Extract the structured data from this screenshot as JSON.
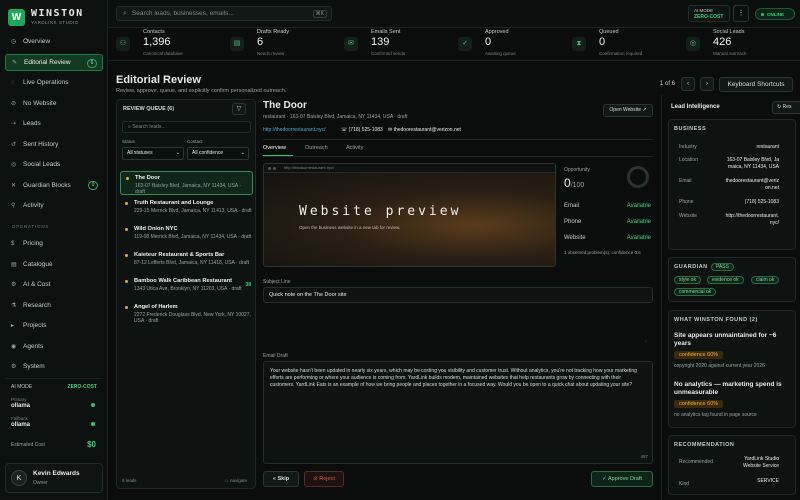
{
  "brand": {
    "name": "WINSTON",
    "subtitle": "YARDLINK STUDIO",
    "logo_letter": "W"
  },
  "nav": [
    {
      "label": "Overview",
      "icon": "dashboard-icon",
      "glyph": "◷"
    },
    {
      "label": "Editorial Review",
      "icon": "edit-icon",
      "glyph": "✎",
      "badge": "6",
      "active": true
    },
    {
      "label": "Live Operations",
      "icon": "pulse-icon",
      "glyph": "◌"
    },
    {
      "label": "No Website",
      "icon": "globe-off-icon",
      "glyph": "⊘"
    },
    {
      "label": "Leads",
      "icon": "target-icon",
      "glyph": "⇢"
    },
    {
      "label": "Sent History",
      "icon": "history-icon",
      "glyph": "↺"
    },
    {
      "label": "Social Leads",
      "icon": "social-icon",
      "glyph": "◎"
    },
    {
      "label": "Guardian Blocks",
      "icon": "shield-x-icon",
      "glyph": "✕",
      "badge": "0"
    },
    {
      "label": "Activity",
      "icon": "activity-icon",
      "glyph": "⚲"
    }
  ],
  "operations_label": "OPERATIONS",
  "ops_nav": [
    {
      "label": "Pricing",
      "icon": "dollar-icon",
      "glyph": "$"
    },
    {
      "label": "Catalogue",
      "icon": "book-icon",
      "glyph": "▤"
    },
    {
      "label": "AI & Cost",
      "icon": "gear-icon",
      "glyph": "⚙"
    },
    {
      "label": "Research",
      "icon": "research-icon",
      "glyph": "⚗"
    },
    {
      "label": "Projects",
      "icon": "folder-icon",
      "glyph": "▸"
    },
    {
      "label": "Agents",
      "icon": "agent-icon",
      "glyph": "◉"
    },
    {
      "label": "System",
      "icon": "system-icon",
      "glyph": "⚙"
    }
  ],
  "ai_mode": {
    "label": "AI MODE",
    "mode": "ZERO-COST",
    "primary_label": "Primary",
    "primary": "ollama",
    "fallback_label": "Fallback",
    "fallback": "ollama",
    "cost_label": "Estimated Cost",
    "cost": "$0"
  },
  "user": {
    "initial": "K",
    "name": "Kevin Edwards",
    "role": "Owner"
  },
  "topbar": {
    "search_placeholder": "Search leads, businesses, emails...",
    "kbd": "⌘K",
    "mode_label": "AI MODE",
    "mode_value": "ZERO-COST",
    "status": "ONLINE"
  },
  "stats": [
    {
      "label": "Contacts",
      "value": "1,396",
      "sub": "Canonical database",
      "icon": "users-icon",
      "glyph": "⚇"
    },
    {
      "label": "Drafts Ready",
      "value": "6",
      "sub": "Needs review",
      "icon": "draft-icon",
      "glyph": "▤"
    },
    {
      "label": "Emails Sent",
      "value": "139",
      "sub": "Confirmed sends",
      "icon": "send-icon",
      "glyph": "✉"
    },
    {
      "label": "Approved",
      "value": "0",
      "sub": "Awaiting queue",
      "icon": "check-icon",
      "glyph": "✓"
    },
    {
      "label": "Queued",
      "value": "0",
      "sub": "Confirmation required",
      "icon": "hourglass-icon",
      "glyph": "⧗"
    },
    {
      "label": "Social Leads",
      "value": "426",
      "sub": "Manual outreach",
      "icon": "social-icon",
      "glyph": "◎"
    }
  ],
  "review": {
    "title": "Editorial Review",
    "subtitle": "Review, approve, queue, and explicitly confirm personalized outreach.",
    "pager": "1 of 6",
    "prev": "‹",
    "next": "›",
    "shortcuts": "Keyboard Shortcuts"
  },
  "queue": {
    "title": "REVIEW QUEUE (6)",
    "search_placeholder": "Search leads...",
    "status_label": "Status",
    "status_value": "All statuses",
    "contact_label": "Contact",
    "contact_value": "All confidence",
    "items": [
      {
        "name": "The Door",
        "detail": "163-07 Baisley Blvd, Jamaica, NY 11434, USA · draft",
        "selected": true
      },
      {
        "name": "Truth Restaurant and Lounge",
        "detail": "229-15 Merrick Blvd, Jamaica, NY 11413, USA · draft"
      },
      {
        "name": "Wild Onion NYC",
        "detail": "119-08 Merrick Blvd, Jamaica, NY 11434, USA · draft"
      },
      {
        "name": "Kaieteur Restaurant & Sports Bar",
        "detail": "87-12 Lefferts Blvd, Jamaica, NY 11418, USA · draft"
      },
      {
        "name": "Bamboo Walk Caribbean Restaurant",
        "detail": "1343 Utica Ave, Brooklyn, NY 11203, USA · draft",
        "score": "38"
      },
      {
        "name": "Angel of Harlem",
        "detail": "2272 Frederick Douglass Blvd, New York, NY 10027, USA · draft"
      }
    ],
    "footer_left": "6 leads",
    "footer_right": "↑↓ navigate"
  },
  "detail": {
    "name": "The Door",
    "meta": "restaurant · 163-07 Baisley Blvd, Jamaica, NY 11434, USA · draft",
    "url": "http://thedoorrestaurant.nyc/",
    "phone": "☏ (718) 525-1083",
    "email": "✉ thedoorestaurant@verizon.net",
    "open_site": "Open Website ↗",
    "tabs": [
      "Overview",
      "Outreach",
      "Activity"
    ],
    "preview_url": "http://thedoorrestaurant.nyc/",
    "preview_title": "Website preview",
    "preview_sub": "Open the business website in a new tab for review.",
    "opportunity_label": "Opportunity",
    "opportunity_value": "0",
    "opportunity_max": "/100",
    "checks": [
      {
        "label": "Email",
        "value": "Available"
      },
      {
        "label": "Phone",
        "value": "Available"
      },
      {
        "label": "Website",
        "value": "Available"
      }
    ],
    "observed": "1 observed problem(s), confidence 0.6",
    "subject_label": "Subject Line",
    "subject": "Quick note on the The Door site",
    "draft_label": "Email Draft",
    "draft": "Your website hasn't been updated in nearly six years, which may be costing you visibility and customer trust. Without analytics, you're not tracking how your marketing efforts are performing or where your audience is coming from. YardLink builds modern, maintained websites that help restaurants grow by connecting with their customers. YardLink Eats is an example of how we bring people and places together in a focused way. Would you be open to a quick chat about updating your site?",
    "char_count": "497",
    "skip": "« Skip",
    "reject": "⊘ Reject",
    "approve": "✓ Approve Draft"
  },
  "intel": {
    "title": "Lead Intelligence",
    "reset": "↻ Res",
    "business_label": "BUSINESS",
    "business": [
      {
        "k": "Industry",
        "v": "restaurant"
      },
      {
        "k": "Location",
        "v": "163-07 Baisley Blvd, Jamaica, NY 11434, USA"
      },
      {
        "k": "Email",
        "v": "thedoorestaurant@verizon.net"
      },
      {
        "k": "Phone",
        "v": "(718) 525-1083"
      },
      {
        "k": "Website",
        "v": "http://thedoorrestaurant.nyc/"
      }
    ],
    "guardian_label": "GUARDIAN",
    "guardian_status": "PASS",
    "guardian_tags": [
      "style ok",
      "evidence ok",
      "claim ok",
      "commercial ok"
    ],
    "found_label": "WHAT WINSTON FOUND (2)",
    "findings": [
      {
        "title": "Site appears unmaintained for ~6 years",
        "confidence": "confidence 60%",
        "note": "copyright 2020 against current year 2026"
      },
      {
        "title": "No analytics — marketing spend is unmeasurable",
        "confidence": "confidence 60%",
        "note": "no analytics tag found in page source"
      }
    ],
    "rec_label": "RECOMMENDATION",
    "rec": [
      {
        "k": "Recommended",
        "v": "YardLink Studio Website Service"
      },
      {
        "k": "Kind",
        "v": "SERVICE"
      }
    ]
  },
  "colors": {
    "accent": "#1fa85a",
    "warning": "#e0b23a",
    "danger": "#e05a4a"
  }
}
